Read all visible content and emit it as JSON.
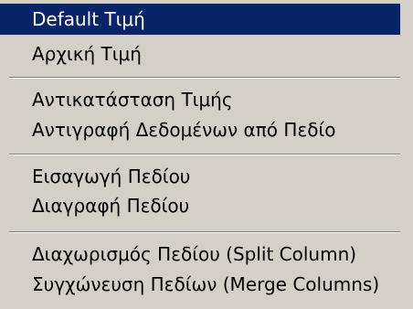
{
  "menu": {
    "colors": {
      "background": "#d4d0c8",
      "highlight": "#0a246a",
      "highlight_text": "#ffffff",
      "text": "#000000"
    },
    "items": [
      {
        "label": "Default Τιμή",
        "highlighted": true
      },
      {
        "label": "Αρχική Τιμή"
      },
      {
        "label": "Αντικατάσταση Τιμής"
      },
      {
        "label": "Αντιγραφή Δεδομένων από Πεδίο"
      },
      {
        "label": "Εισαγωγή Πεδίου"
      },
      {
        "label": "Διαγραφή Πεδίου"
      },
      {
        "label": "Διαχωρισμός Πεδίου (Split Column)"
      },
      {
        "label": "Συγχώνευση Πεδίων (Merge Columns)"
      }
    ]
  }
}
